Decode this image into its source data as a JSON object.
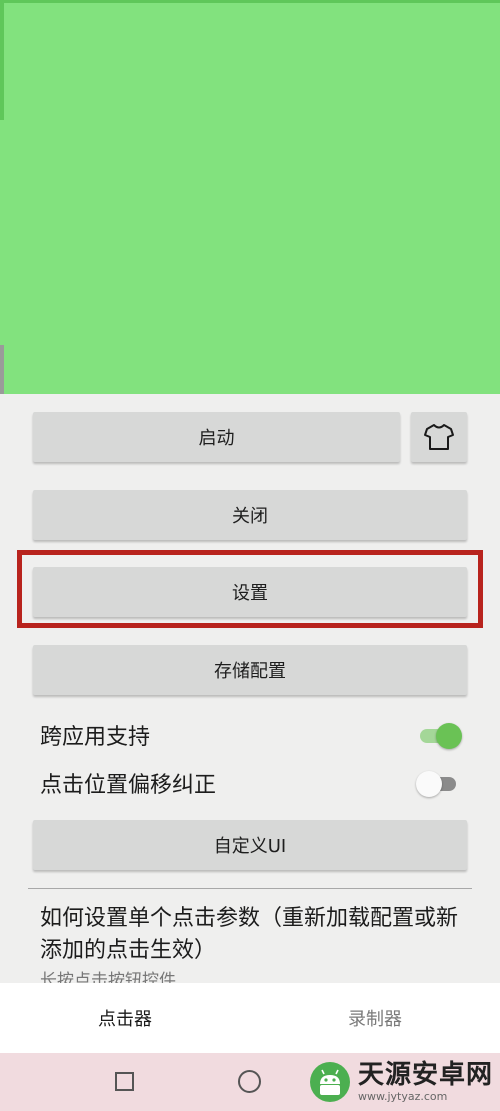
{
  "buttons": {
    "start": "启动",
    "close": "关闭",
    "settings": "设置",
    "save_config": "存储配置",
    "custom_ui": "自定义UI"
  },
  "settings": {
    "cross_app": {
      "label": "跨应用支持",
      "enabled": true
    },
    "offset_correction": {
      "label": "点击位置偏移纠正",
      "enabled": false
    }
  },
  "help": {
    "title": "如何设置单个点击参数（重新加载配置或新添加的点击生效）",
    "subtitle": "长按点击按钮控件"
  },
  "tabs": [
    {
      "label": "点击器",
      "active": true
    },
    {
      "label": "录制器",
      "active": false
    }
  ],
  "icons": {
    "skin": "tshirt-icon",
    "nav_recent": "square-icon",
    "nav_home": "circle-icon"
  },
  "colors": {
    "header": "#82e27e",
    "highlight": "#b8231d",
    "switch_on": "#6ac255"
  },
  "watermark": {
    "title": "天源安卓网",
    "url": "www.jytyaz.com"
  }
}
